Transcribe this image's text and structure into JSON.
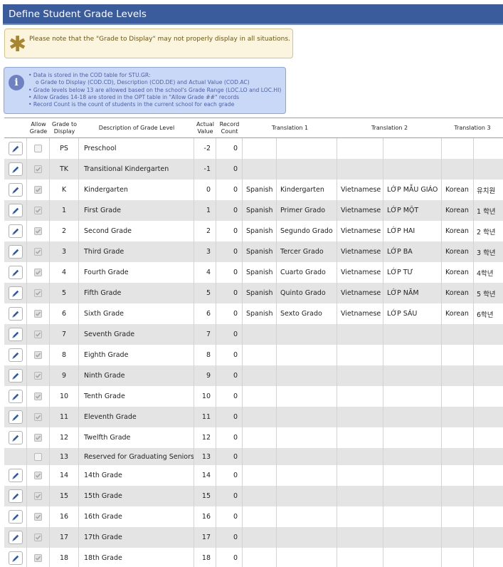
{
  "title": "Define Student Grade Levels",
  "note": {
    "icon": "asterisk-icon",
    "text": "Please note that the \"Grade to Display\" may not properly display in all situations."
  },
  "info": {
    "icon": "info-icon",
    "lines": [
      "• Data is stored in the COD table for STU.GR:",
      "o Grade to Display (COD.CD), Description (COD.DE) and Actual Value (COD.AC)",
      "• Grade levels below 13 are allowed based on the school's Grade Range (LOC.LO and LOC.HI)",
      "• Allow Grades 14-18 are stored in the OPT table in \"Allow Grade ##\" records",
      "• Record Count is the count of students in the current school for each grade"
    ]
  },
  "columns": {
    "allow_grade": "Allow Grade",
    "grade_to_display": "Grade to Display",
    "description": "Description of Grade Level",
    "actual_value": "Actual Value",
    "record_count": "Record Count",
    "translation1": "Translation 1",
    "translation2": "Translation 2",
    "translation3": "Translation 3"
  },
  "colors": {
    "title_bar": "#3b5c9c",
    "row_alt": "#e4e4e4",
    "note_bg": "#fbf4df",
    "info_bg": "#c9d8f6",
    "edit_icon": "#2d58a8"
  },
  "rows": [
    {
      "editable": true,
      "allow": false,
      "disabled": false,
      "grade": "PS",
      "desc": "Preschool",
      "actual": "-2",
      "count": "0",
      "l1": "",
      "t1": "",
      "l2": "",
      "t2": "",
      "l3": "",
      "t3": ""
    },
    {
      "editable": true,
      "allow": true,
      "disabled": true,
      "grade": "TK",
      "desc": "Transitional Kindergarten",
      "actual": "-1",
      "count": "0",
      "l1": "",
      "t1": "",
      "l2": "",
      "t2": "",
      "l3": "",
      "t3": ""
    },
    {
      "editable": true,
      "allow": true,
      "disabled": true,
      "grade": "K",
      "desc": "Kindergarten",
      "actual": "0",
      "count": "0",
      "l1": "Spanish",
      "t1": "Kindergarten",
      "l2": "Vietnamese",
      "t2": "LỚP MẪU GIÁO",
      "l3": "Korean",
      "t3": "유치원"
    },
    {
      "editable": true,
      "allow": true,
      "disabled": true,
      "grade": "1",
      "desc": "First Grade",
      "actual": "1",
      "count": "0",
      "l1": "Spanish",
      "t1": "Primer Grado",
      "l2": "Vietnamese",
      "t2": "LỚP MỘT",
      "l3": "Korean",
      "t3": "1 학년"
    },
    {
      "editable": true,
      "allow": true,
      "disabled": true,
      "grade": "2",
      "desc": "Second Grade",
      "actual": "2",
      "count": "0",
      "l1": "Spanish",
      "t1": "Segundo Grado",
      "l2": "Vietnamese",
      "t2": "LỚP HAI",
      "l3": "Korean",
      "t3": "2 학년"
    },
    {
      "editable": true,
      "allow": true,
      "disabled": true,
      "grade": "3",
      "desc": "Third Grade",
      "actual": "3",
      "count": "0",
      "l1": "Spanish",
      "t1": "Tercer Grado",
      "l2": "Vietnamese",
      "t2": "LỚP BA",
      "l3": "Korean",
      "t3": "3 학년"
    },
    {
      "editable": true,
      "allow": true,
      "disabled": true,
      "grade": "4",
      "desc": "Fourth Grade",
      "actual": "4",
      "count": "0",
      "l1": "Spanish",
      "t1": "Cuarto Grado",
      "l2": "Vietnamese",
      "t2": "LỚP TƯ",
      "l3": "Korean",
      "t3": "4학년"
    },
    {
      "editable": true,
      "allow": true,
      "disabled": true,
      "grade": "5",
      "desc": "Fifth Grade",
      "actual": "5",
      "count": "0",
      "l1": "Spanish",
      "t1": "Quinto Grado",
      "l2": "Vietnamese",
      "t2": "LỚP NĂM",
      "l3": "Korean",
      "t3": "5 학년"
    },
    {
      "editable": true,
      "allow": true,
      "disabled": true,
      "grade": "6",
      "desc": "Sixth Grade",
      "actual": "6",
      "count": "0",
      "l1": "Spanish",
      "t1": "Sexto Grado",
      "l2": "Vietnamese",
      "t2": "LỚP SÁU",
      "l3": "Korean",
      "t3": "6학년"
    },
    {
      "editable": true,
      "allow": true,
      "disabled": true,
      "grade": "7",
      "desc": "Seventh Grade",
      "actual": "7",
      "count": "0",
      "l1": "",
      "t1": "",
      "l2": "",
      "t2": "",
      "l3": "",
      "t3": ""
    },
    {
      "editable": true,
      "allow": true,
      "disabled": true,
      "grade": "8",
      "desc": "Eighth Grade",
      "actual": "8",
      "count": "0",
      "l1": "",
      "t1": "",
      "l2": "",
      "t2": "",
      "l3": "",
      "t3": ""
    },
    {
      "editable": true,
      "allow": true,
      "disabled": true,
      "grade": "9",
      "desc": "Ninth Grade",
      "actual": "9",
      "count": "0",
      "l1": "",
      "t1": "",
      "l2": "",
      "t2": "",
      "l3": "",
      "t3": ""
    },
    {
      "editable": true,
      "allow": true,
      "disabled": true,
      "grade": "10",
      "desc": "Tenth Grade",
      "actual": "10",
      "count": "0",
      "l1": "",
      "t1": "",
      "l2": "",
      "t2": "",
      "l3": "",
      "t3": ""
    },
    {
      "editable": true,
      "allow": true,
      "disabled": true,
      "grade": "11",
      "desc": "Eleventh Grade",
      "actual": "11",
      "count": "0",
      "l1": "",
      "t1": "",
      "l2": "",
      "t2": "",
      "l3": "",
      "t3": ""
    },
    {
      "editable": true,
      "allow": true,
      "disabled": true,
      "grade": "12",
      "desc": "Twelfth Grade",
      "actual": "12",
      "count": "0",
      "l1": "",
      "t1": "",
      "l2": "",
      "t2": "",
      "l3": "",
      "t3": ""
    },
    {
      "editable": false,
      "allow": false,
      "disabled": true,
      "grade": "13",
      "desc": "Reserved for Graduating Seniors",
      "actual": "13",
      "count": "0",
      "l1": "",
      "t1": "",
      "l2": "",
      "t2": "",
      "l3": "",
      "t3": ""
    },
    {
      "editable": true,
      "allow": true,
      "disabled": true,
      "grade": "14",
      "desc": "14th Grade",
      "actual": "14",
      "count": "0",
      "l1": "",
      "t1": "",
      "l2": "",
      "t2": "",
      "l3": "",
      "t3": ""
    },
    {
      "editable": true,
      "allow": true,
      "disabled": true,
      "grade": "15",
      "desc": "15th Grade",
      "actual": "15",
      "count": "0",
      "l1": "",
      "t1": "",
      "l2": "",
      "t2": "",
      "l3": "",
      "t3": ""
    },
    {
      "editable": true,
      "allow": true,
      "disabled": true,
      "grade": "16",
      "desc": "16th Grade",
      "actual": "16",
      "count": "0",
      "l1": "",
      "t1": "",
      "l2": "",
      "t2": "",
      "l3": "",
      "t3": ""
    },
    {
      "editable": true,
      "allow": true,
      "disabled": true,
      "grade": "17",
      "desc": "17th Grade",
      "actual": "17",
      "count": "0",
      "l1": "",
      "t1": "",
      "l2": "",
      "t2": "",
      "l3": "",
      "t3": ""
    },
    {
      "editable": true,
      "allow": true,
      "disabled": true,
      "grade": "18",
      "desc": "18th Grade",
      "actual": "18",
      "count": "0",
      "l1": "",
      "t1": "",
      "l2": "",
      "t2": "",
      "l3": "",
      "t3": ""
    }
  ]
}
